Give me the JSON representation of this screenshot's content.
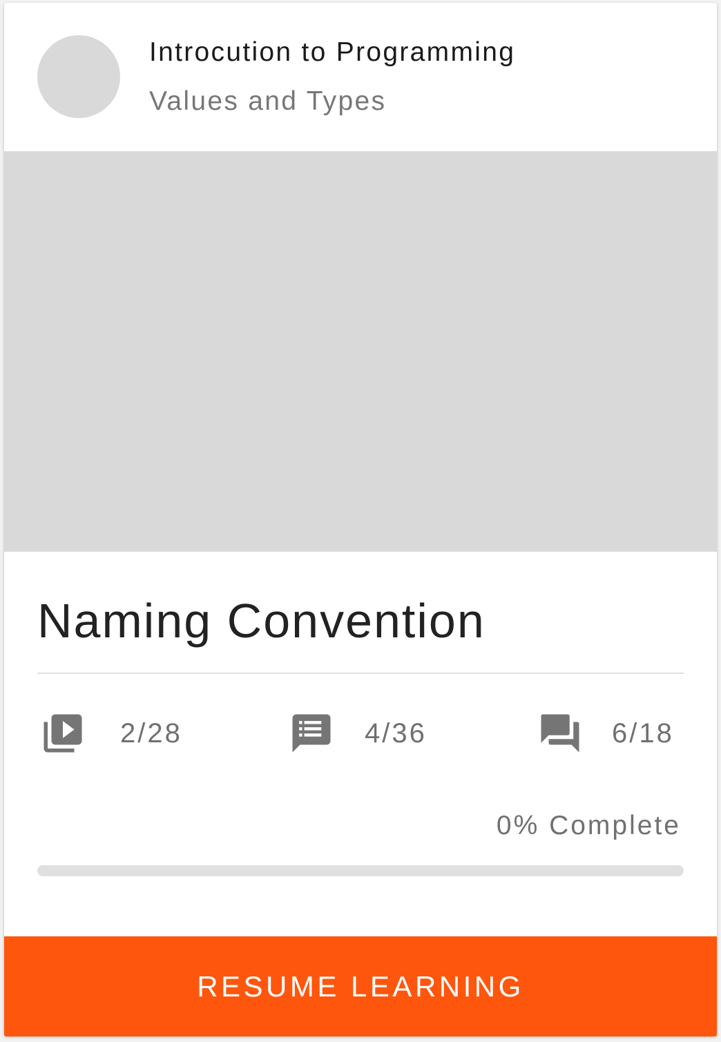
{
  "header": {
    "course_title": "Introcution to Programming",
    "course_subtitle": "Values and Types"
  },
  "lesson": {
    "title": "Naming Convention"
  },
  "stats": {
    "videos": {
      "icon": "video-library-icon",
      "value": "2/28"
    },
    "notes": {
      "icon": "list-message-icon",
      "value": "4/36"
    },
    "questions": {
      "icon": "forum-icon",
      "value": "6/18"
    }
  },
  "progress": {
    "label": "0% Complete",
    "percent": 0
  },
  "actions": {
    "resume_label": "RESUME LEARNING"
  },
  "colors": {
    "accent": "#ff560d",
    "placeholder": "#d9d9d9",
    "icon": "#757575"
  }
}
